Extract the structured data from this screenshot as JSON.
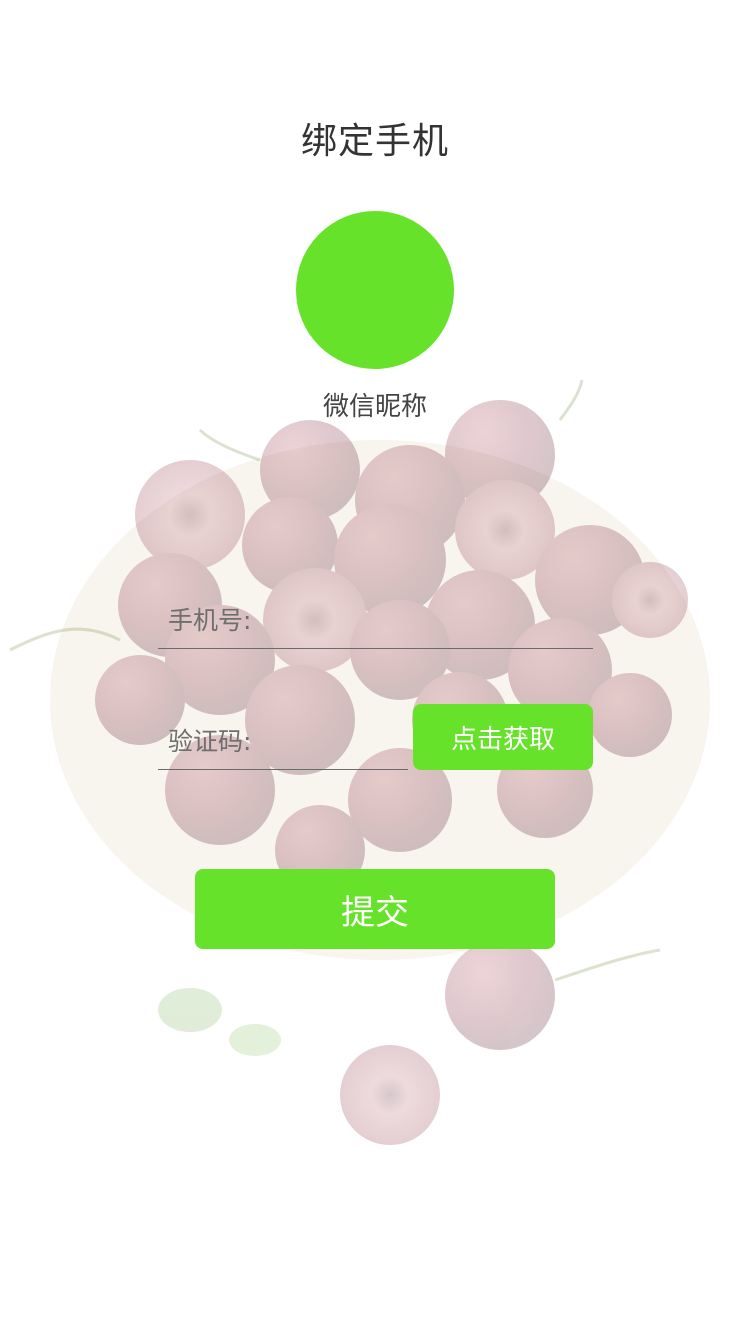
{
  "header": {
    "title": "绑定手机"
  },
  "profile": {
    "nickname": "微信昵称",
    "avatar_color": "#67e22a"
  },
  "form": {
    "phone": {
      "label": "手机号:",
      "value": "",
      "placeholder": ""
    },
    "code": {
      "label": "验证码:",
      "value": "",
      "placeholder": ""
    },
    "get_code_label": "点击获取",
    "submit_label": "提交"
  },
  "theme": {
    "accent": "#67e22a",
    "text": "#333333",
    "background": "#ffffff"
  },
  "background_image": {
    "subject": "cherries-in-wooden-bowl"
  }
}
